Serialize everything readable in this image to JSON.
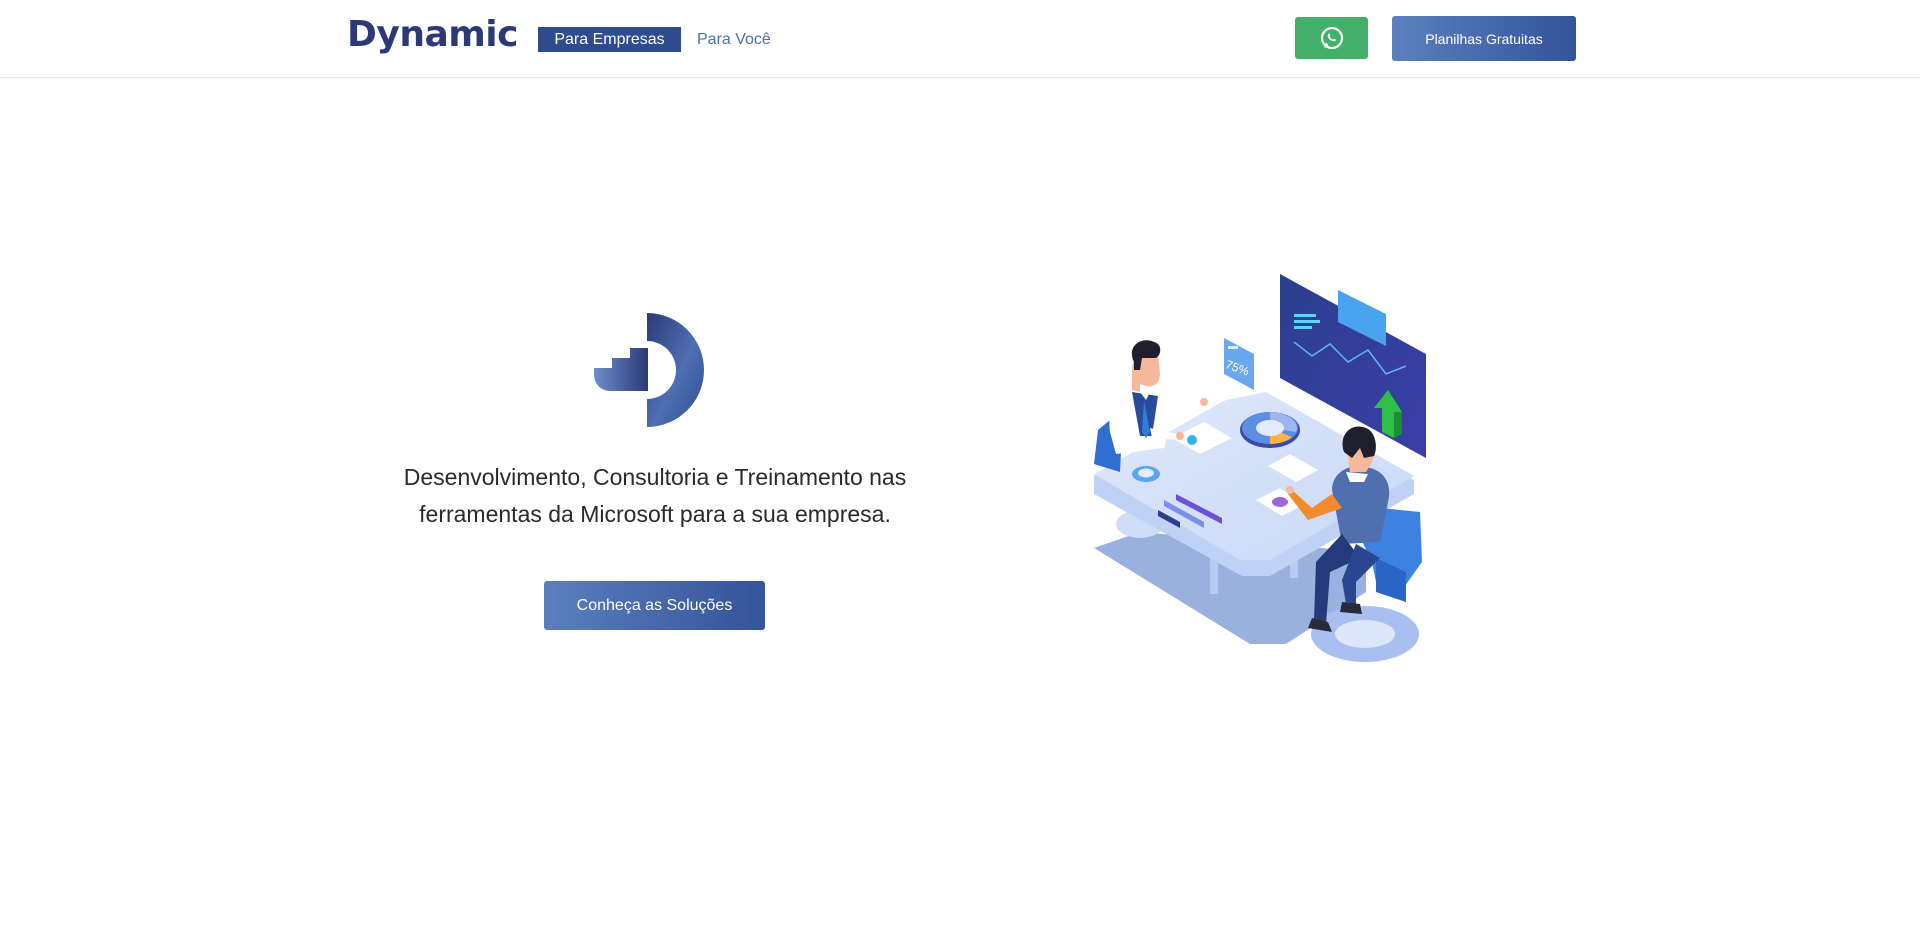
{
  "header": {
    "logo_text": "Dynamic",
    "nav": [
      {
        "label": "Para Empresas",
        "active": true
      },
      {
        "label": "Para Você",
        "active": false
      }
    ],
    "whatsapp_icon": "whatsapp-icon",
    "cta_label": "Planilhas Gratuitas"
  },
  "hero": {
    "tagline_line1": "Desenvolvimento, Consultoria e Treinamento nas",
    "tagline_line2": "ferramentas da Microsoft para a sua empresa.",
    "cta_label": "Conheça as Soluções",
    "illustration": {
      "badge_value": "75%"
    }
  },
  "colors": {
    "brand": "#2b3a77",
    "nav_active_bg": "#2f4c8f",
    "nav_link": "#4b6fb0",
    "whatsapp": "#43b06a",
    "button_gradient_start": "#5c80bd",
    "button_gradient_end": "#34539a"
  }
}
